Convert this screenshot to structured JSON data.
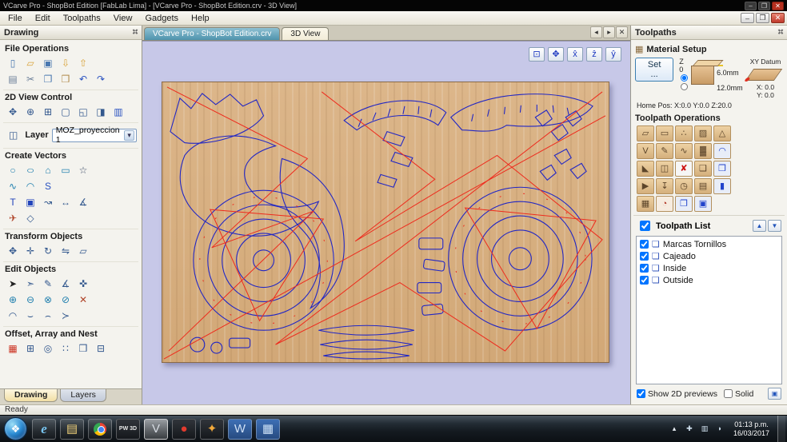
{
  "window": {
    "title": "VCarve Pro - ShopBot Edition [FabLab Lima] - [VCarve Pro - ShopBot Edition.crv - 3D View]",
    "menu": [
      "File",
      "Edit",
      "Toolpaths",
      "View",
      "Gadgets",
      "Help"
    ],
    "controls": {
      "min": "–",
      "max": "❐",
      "close": "✕"
    }
  },
  "glyphs": {
    "pin": "✜",
    "layer": "◫",
    "combo_arrow": "▾",
    "left_arrow": "◂",
    "right_arrow": "▸",
    "close": "✕",
    "up": "▲",
    "down": "▼",
    "monitor": "▣",
    "material": "▦",
    "start": "❖",
    "toolpath": "❏"
  },
  "drawing_panel": {
    "title": "Drawing",
    "sections": {
      "file_operations": "File Operations",
      "view_control": "2D View Control",
      "layer_label": "Layer",
      "create_vectors": "Create Vectors",
      "transform_objects": "Transform Objects",
      "edit_objects": "Edit Objects",
      "offset_array": "Offset, Array and Nest"
    },
    "layer_value": "MOZ_proyeccion 1",
    "tabs": [
      "Drawing",
      "Layers"
    ]
  },
  "canvas": {
    "tabs": [
      "VCarve Pro - ShopBot Edition.crv",
      "3D View"
    ]
  },
  "toolpaths_panel": {
    "title": "Toolpaths",
    "material_setup": {
      "label": "Material Setup",
      "set_button": "Set ...",
      "z_label": "Z 0",
      "z_top_selected": true,
      "z_bottom_selected": false,
      "thickness_top": "6.0mm",
      "thickness_bottom": "12.0mm",
      "xy_datum": "XY Datum",
      "datum_x": "X: 0.0",
      "datum_y": "Y: 0.0",
      "home_pos": "Home Pos: X:0.0 Y:0.0 Z:20.0"
    },
    "operations_label": "Toolpath Operations",
    "toolpath_list": {
      "label": "Toolpath List",
      "header_checked": true,
      "items": [
        {
          "label": "Marcas Tornillos",
          "checked": true
        },
        {
          "label": "Cajeado",
          "checked": true
        },
        {
          "label": "Inside",
          "checked": true
        },
        {
          "label": "Outside",
          "checked": true
        }
      ]
    },
    "footer": {
      "show_2d": "Show 2D previews",
      "show_2d_checked": true,
      "solid": "Solid",
      "solid_checked": false
    }
  },
  "status_bar": "Ready",
  "taskbar": {
    "time": "01:13 p.m.",
    "date": "16/03/2017"
  },
  "colors": {
    "vector_blue": "#2227c4",
    "vector_red": "#ee2a1c",
    "canvas_bg": "#c7c8e8",
    "wood": "#d8b286"
  },
  "icons": {
    "file_ops_1": [
      {
        "n": "new-file-icon",
        "g": "▯",
        "c": "#4a78b0"
      },
      {
        "n": "open-file-icon",
        "g": "▱",
        "c": "#d9a33c"
      },
      {
        "n": "save-file-icon",
        "g": "▣",
        "c": "#4a78b0"
      },
      {
        "n": "import-vectors-icon",
        "g": "⇩",
        "c": "#d9a33c"
      },
      {
        "n": "export-vectors-icon",
        "g": "⇧",
        "c": "#d9a33c"
      }
    ],
    "file_ops_2": [
      {
        "n": "print-icon",
        "g": "▤",
        "c": "#6b7f99"
      },
      {
        "n": "cut-icon",
        "g": "✂",
        "c": "#6b7f99"
      },
      {
        "n": "copy-icon",
        "g": "❐",
        "c": "#4a78b0"
      },
      {
        "n": "paste-icon",
        "g": "❒",
        "c": "#b08a4a"
      },
      {
        "n": "undo-icon",
        "g": "↶",
        "c": "#2a52c0"
      },
      {
        "n": "redo-icon",
        "g": "↷",
        "c": "#2a52c0"
      }
    ],
    "view_ctrl": [
      {
        "n": "pan-icon",
        "g": "✥",
        "c": "#33588e"
      },
      {
        "n": "zoom-icon",
        "g": "⊕",
        "c": "#33588e"
      },
      {
        "n": "zoom-window-icon",
        "g": "⊞",
        "c": "#33588e"
      },
      {
        "n": "zoom-extents-icon",
        "g": "▢",
        "c": "#33588e"
      },
      {
        "n": "zoom-selected-icon",
        "g": "◱",
        "c": "#33588e"
      },
      {
        "n": "previous-view-icon",
        "g": "◨",
        "c": "#33588e"
      },
      {
        "n": "toggle-2d3d-icon",
        "g": "▥",
        "c": "#2a52c0"
      }
    ],
    "create_1": [
      {
        "n": "draw-circle-icon",
        "g": "○",
        "c": "#1f7fae"
      },
      {
        "n": "draw-ellipse-icon",
        "g": "○",
        "c": "#1f7fae",
        "cls": "wide"
      },
      {
        "n": "draw-polygon-icon",
        "g": "⌂",
        "c": "#1f7fae"
      },
      {
        "n": "draw-rectangle-icon",
        "g": "▭",
        "c": "#1f7fae"
      },
      {
        "n": "draw-star-icon",
        "g": "☆",
        "c": "#3a4a66"
      }
    ],
    "create_2": [
      {
        "n": "draw-polyline-icon",
        "g": "∿",
        "c": "#1f7fae"
      },
      {
        "n": "draw-arc-icon",
        "g": "◠",
        "c": "#1f7fae"
      },
      {
        "n": "draw-curve-icon",
        "g": "S",
        "c": "#2a52c0"
      }
    ],
    "create_3": [
      {
        "n": "draw-text-icon",
        "g": "T",
        "c": "#2244bb"
      },
      {
        "n": "text-box-icon",
        "g": "▣",
        "c": "#2244bb"
      },
      {
        "n": "text-on-curve-icon",
        "g": "↝",
        "c": "#33588e"
      },
      {
        "n": "dimension-icon",
        "g": "↔",
        "c": "#33588e"
      },
      {
        "n": "angle-dimension-icon",
        "g": "∡",
        "c": "#33588e"
      }
    ],
    "create_4": [
      {
        "n": "insert-clipart-icon",
        "g": "✈",
        "c": "#b0452a"
      },
      {
        "n": "vector-boolean-icon",
        "g": "◇",
        "c": "#33588e"
      }
    ],
    "transform": [
      {
        "n": "move-selection-icon",
        "g": "✥",
        "c": "#33588e"
      },
      {
        "n": "set-position-icon",
        "g": "✛",
        "c": "#33588e"
      },
      {
        "n": "rotate-icon",
        "g": "↻",
        "c": "#33588e"
      },
      {
        "n": "mirror-icon",
        "g": "⇋",
        "c": "#33588e"
      },
      {
        "n": "distort-icon",
        "g": "▱",
        "c": "#33588e"
      }
    ],
    "edit_1": [
      {
        "n": "select-icon",
        "g": "➤",
        "c": "#222"
      },
      {
        "n": "node-edit-icon",
        "g": "➣",
        "c": "#33588e"
      },
      {
        "n": "edit-draw-icon",
        "g": "✎",
        "c": "#33588e"
      },
      {
        "n": "measure-icon",
        "g": "∡",
        "c": "#33588e"
      },
      {
        "n": "snap-icon",
        "g": "✜",
        "c": "#33588e"
      }
    ],
    "edit_2": [
      {
        "n": "weld-vectors-icon",
        "g": "⊕",
        "c": "#1f7fae"
      },
      {
        "n": "subtract-vectors-icon",
        "g": "⊖",
        "c": "#1f7fae"
      },
      {
        "n": "intersect-vectors-icon",
        "g": "⊗",
        "c": "#1f7fae"
      },
      {
        "n": "trim-vectors-icon",
        "g": "⊘",
        "c": "#1f7fae"
      },
      {
        "n": "delete-vectors-icon",
        "g": "✕",
        "c": "#b0452a"
      }
    ],
    "edit_3": [
      {
        "n": "fit-arc-icon",
        "g": "◠",
        "c": "#33588e"
      },
      {
        "n": "close-vector-icon",
        "g": "⌣",
        "c": "#33588e"
      },
      {
        "n": "join-vectors-icon",
        "g": "⌢",
        "c": "#33588e"
      },
      {
        "n": "vector-direction-icon",
        "g": "≻",
        "c": "#33588e"
      }
    ],
    "offset_1": [
      {
        "n": "offset-vectors-icon",
        "g": "▦",
        "c": "#cc3322"
      },
      {
        "n": "array-copy-icon",
        "g": "⊞",
        "c": "#33588e"
      },
      {
        "n": "circular-array-icon",
        "g": "◎",
        "c": "#33588e"
      },
      {
        "n": "copy-along-vector-icon",
        "g": "∷",
        "c": "#33588e"
      },
      {
        "n": "nesting-icon",
        "g": "❒",
        "c": "#33588e"
      },
      {
        "n": "true-shape-nesting-icon",
        "g": "⊟",
        "c": "#33588e"
      }
    ],
    "ops_1": [
      {
        "n": "profile-toolpath-icon",
        "g": "▱"
      },
      {
        "n": "pocket-toolpath-icon",
        "g": "▭"
      },
      {
        "n": "drilling-toolpath-icon",
        "g": "∴"
      },
      {
        "n": "quick-engrave-icon",
        "g": "▨"
      },
      {
        "n": "thread-mill-icon",
        "g": "△"
      }
    ],
    "ops_2": [
      {
        "n": "vcarve-toolpath-icon",
        "g": "V"
      },
      {
        "n": "engrave-toolpath-icon",
        "g": "✎"
      },
      {
        "n": "fluting-toolpath-icon",
        "g": "∿"
      },
      {
        "n": "texture-toolpath-icon",
        "g": "▓"
      },
      {
        "n": "prism-carve-icon",
        "g": "◠",
        "c": "#2244cc",
        "bg": "#e8edf8"
      }
    ],
    "ops_3": [
      {
        "n": "moulding-toolpath-icon",
        "g": "◣"
      },
      {
        "n": "inlay-toolpath-icon",
        "g": "◫"
      },
      {
        "n": "delete-toolpath-icon",
        "g": "✘",
        "c": "#cc1111",
        "bg": "#f6f6f6"
      },
      {
        "n": "toolpath-template-icon",
        "g": "❑"
      },
      {
        "n": "merge-toolpaths-icon",
        "g": "❒",
        "c": "#2244cc",
        "bg": "#e8edf8"
      }
    ],
    "ops_4": [
      {
        "n": "preview-toolpaths-icon",
        "g": "▶"
      },
      {
        "n": "save-toolpath-icon",
        "g": "↧"
      },
      {
        "n": "estimate-time-icon",
        "g": "◷"
      },
      {
        "n": "toolpath-summary-icon",
        "g": "▤"
      },
      {
        "n": "toolpath-tiling-icon",
        "g": "▮",
        "c": "#2244cc",
        "bg": "#e8edf8"
      }
    ],
    "ops_5": [
      {
        "n": "material-setup-icon",
        "g": "▦"
      },
      {
        "n": "machining-time-icon",
        "g": "◔",
        "c": "#b03322",
        "bg": "#f6ece0"
      },
      {
        "n": "copy-toolpath-icon",
        "g": "❐",
        "c": "#2244cc",
        "bg": "#e8edf8"
      },
      {
        "n": "toolpath-drawing-icon",
        "g": "▣",
        "c": "#2244cc",
        "bg": "#e8edf8"
      }
    ],
    "canvas_ctrl": [
      {
        "n": "fit-to-view-icon",
        "g": "⊡"
      },
      {
        "n": "pan-view-icon",
        "g": "✥"
      },
      {
        "n": "view-x-axis-icon",
        "g": "x̂"
      },
      {
        "n": "view-z-axis-icon",
        "g": "ẑ"
      },
      {
        "n": "view-y-axis-icon",
        "g": "ŷ"
      }
    ],
    "taskbar_apps": [
      {
        "n": "internet-explorer-icon",
        "g": "e",
        "c": "#79c6f2",
        "cls": "ie"
      },
      {
        "n": "windows-explorer-icon",
        "g": "▤",
        "c": "#f2d37a"
      },
      {
        "n": "chrome-icon",
        "g": "",
        "cls": "chrome"
      },
      {
        "n": "pw3d-app-icon",
        "g": "PW 3D",
        "c": "#e8e8e8",
        "cls": "dark tiny"
      },
      {
        "n": "vcarve-app-icon",
        "g": "V",
        "c": "#d8dde4",
        "cls": "active"
      },
      {
        "n": "shopbot-app-icon",
        "g": "●",
        "c": "#e23b2e",
        "cls": "dark"
      },
      {
        "n": "partworks-app-icon",
        "g": "✦",
        "c": "#f2a93b",
        "cls": "dark"
      },
      {
        "n": "word-app-icon",
        "g": "W",
        "c": "#cfe0f5",
        "cls": "blue"
      },
      {
        "n": "app-icon-blue",
        "g": "▦",
        "c": "#cfe3f7",
        "cls": "blue"
      }
    ],
    "tray": [
      {
        "n": "hidden-icons-icon",
        "g": "▴",
        "c": "#e8eef4"
      },
      {
        "n": "action-center-icon",
        "g": "✚",
        "c": "#cfe0ee"
      },
      {
        "n": "network-icon",
        "g": "▥",
        "c": "#cfe0ee"
      },
      {
        "n": "volume-icon",
        "g": "◗",
        "c": "#cfe0ee"
      }
    ]
  }
}
